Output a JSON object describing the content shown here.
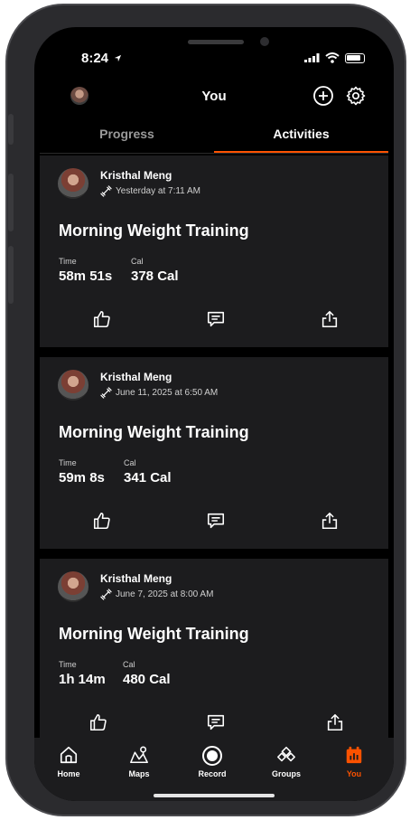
{
  "status_bar": {
    "time": "8:24"
  },
  "header": {
    "title": "You"
  },
  "tabs": [
    {
      "label": "Progress",
      "active": false
    },
    {
      "label": "Activities",
      "active": true
    }
  ],
  "activities": [
    {
      "athlete": "Kristhal Meng",
      "datetime": "Yesterday at 7:11 AM",
      "title": "Morning Weight Training",
      "stats": [
        {
          "label": "Time",
          "value": "58m 51s"
        },
        {
          "label": "Cal",
          "value": "378 Cal"
        }
      ]
    },
    {
      "athlete": "Kristhal Meng",
      "datetime": "June 11, 2025 at 6:50 AM",
      "title": "Morning Weight Training",
      "stats": [
        {
          "label": "Time",
          "value": "59m 8s"
        },
        {
          "label": "Cal",
          "value": "341 Cal"
        }
      ]
    },
    {
      "athlete": "Kristhal Meng",
      "datetime": "June 7, 2025 at 8:00 AM",
      "title": "Morning Weight Training",
      "stats": [
        {
          "label": "Time",
          "value": "1h 14m"
        },
        {
          "label": "Cal",
          "value": "480 Cal"
        }
      ]
    }
  ],
  "bottom_nav": [
    {
      "label": "Home",
      "icon": "home-icon",
      "active": false
    },
    {
      "label": "Maps",
      "icon": "map-icon",
      "active": false
    },
    {
      "label": "Record",
      "icon": "record-icon",
      "active": false
    },
    {
      "label": "Groups",
      "icon": "groups-icon",
      "active": false
    },
    {
      "label": "You",
      "icon": "calendar-you-icon",
      "active": true
    }
  ],
  "colors": {
    "accent": "#fc5200",
    "background": "#000000",
    "card": "#1c1c1e"
  }
}
